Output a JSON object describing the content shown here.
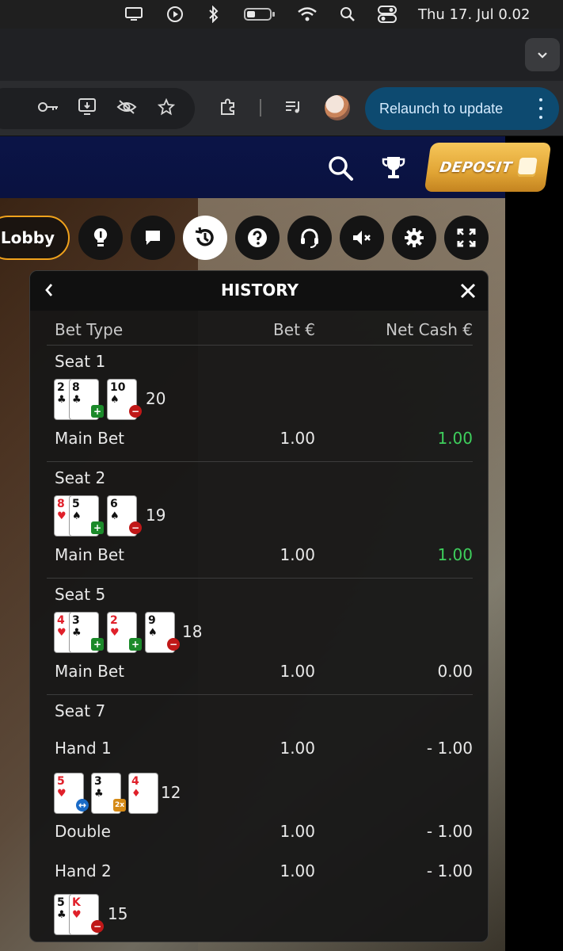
{
  "menubar": {
    "icons": [
      "display-icon",
      "play-icon",
      "bluetooth-icon",
      "battery-icon",
      "wifi-icon",
      "search-icon",
      "control-center-icon"
    ],
    "clock": "Thu 17. Jul  0.02"
  },
  "browser": {
    "relaunch_label": "Relaunch to update"
  },
  "header": {
    "deposit_label": "DEPOSIT"
  },
  "controls": {
    "lobby_label": "Lobby",
    "buttons": [
      "bulb-icon",
      "chat-icon",
      "history-icon",
      "help-icon",
      "support-icon",
      "mute-icon",
      "settings-icon",
      "fullscreen-icon"
    ],
    "active": "history-icon"
  },
  "history": {
    "title": "HISTORY",
    "columns": {
      "bet_type": "Bet Type",
      "bet": "Bet €",
      "net_cash": "Net Cash €"
    },
    "seats": [
      {
        "label": "Seat 1",
        "total": "20",
        "cards": [
          {
            "rank": "2",
            "suit": "♣",
            "color": "black"
          },
          {
            "rank": "8",
            "suit": "♣",
            "color": "black"
          },
          {
            "rank": "10",
            "suit": "♠",
            "color": "black"
          }
        ],
        "bet_label": "Main Bet",
        "bet": "1.00",
        "net": "1.00"
      },
      {
        "label": "Seat 2",
        "total": "19",
        "cards": [
          {
            "rank": "8",
            "suit": "♥",
            "color": "red"
          },
          {
            "rank": "5",
            "suit": "♠",
            "color": "black"
          },
          {
            "rank": "6",
            "suit": "♠",
            "color": "black"
          }
        ],
        "bet_label": "Main Bet",
        "bet": "1.00",
        "net": "1.00"
      },
      {
        "label": "Seat 5",
        "total": "18",
        "cards": [
          {
            "rank": "4",
            "suit": "♥",
            "color": "red"
          },
          {
            "rank": "3",
            "suit": "♣",
            "color": "black"
          },
          {
            "rank": "2",
            "suit": "♥",
            "color": "red"
          },
          {
            "rank": "9",
            "suit": "♠",
            "color": "black"
          }
        ],
        "bet_label": "Main Bet",
        "bet": "1.00",
        "net": "0.00"
      },
      {
        "label": "Seat 7",
        "hands": [
          {
            "label": "Hand 1",
            "bet": "1.00",
            "net": "- 1.00",
            "total": "12",
            "cards": [
              {
                "rank": "5",
                "suit": "♥",
                "color": "red"
              },
              {
                "rank": "3",
                "suit": "♣",
                "color": "black"
              },
              {
                "rank": "4",
                "suit": "♦",
                "color": "red"
              }
            ],
            "extra_label": "Double",
            "extra_bet": "1.00",
            "extra_net": "- 1.00"
          },
          {
            "label": "Hand 2",
            "bet": "1.00",
            "net": "- 1.00",
            "total": "15",
            "cards": [
              {
                "rank": "5",
                "suit": "♣",
                "color": "black"
              },
              {
                "rank": "K",
                "suit": "♥",
                "color": "red"
              }
            ]
          }
        ]
      }
    ],
    "colors": {
      "positive": "#3ecf5c",
      "accent": "#f0a21c"
    }
  }
}
